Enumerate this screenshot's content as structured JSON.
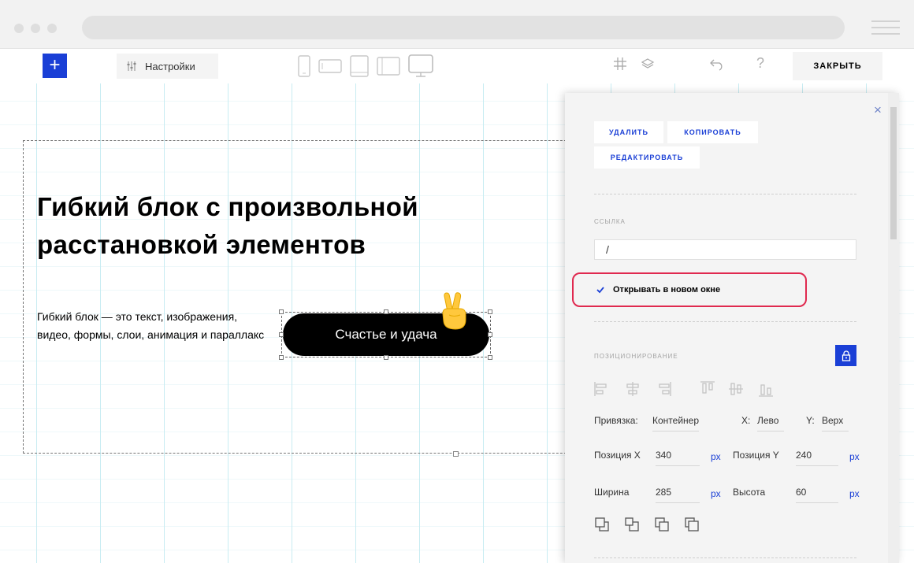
{
  "toolbar": {
    "add_label": "+",
    "settings_label": "Настройки",
    "close_label": "ЗАКРЫТЬ",
    "help_label": "?"
  },
  "canvas": {
    "heading": "Гибкий блок с произвольной расстановкой элементов",
    "subtext": "Гибкий блок — это текст, изображения, видео, формы, слои, анимация и параллакс",
    "button_label": "Счастье и удача",
    "emoji": "✌"
  },
  "panel": {
    "close_label": "×",
    "delete_label": "УДАЛИТЬ",
    "copy_label": "КОПИРОВАТЬ",
    "edit_label": "РЕДАКТИРОВАТЬ",
    "link_label": "ССЫЛКА",
    "link_value": "/",
    "new_window_label": "Открывать в новом окне",
    "new_window_checked": true,
    "positioning_label": "ПОЗИЦИОНИРОВАНИЕ",
    "anchor_label": "Привязка:",
    "anchor_value": "Контейнер",
    "x_label": "X:",
    "x_value": "Лево",
    "y_label": "Y:",
    "y_value": "Верх",
    "pos_x_label": "Позиция X",
    "pos_x_value": "340",
    "pos_y_label": "Позиция Y",
    "pos_y_value": "240",
    "width_label": "Ширина",
    "width_value": "285",
    "height_label": "Высота",
    "height_value": "60",
    "unit": "px"
  },
  "colors": {
    "accent": "#1a3fd6",
    "highlight": "#e0294f"
  }
}
